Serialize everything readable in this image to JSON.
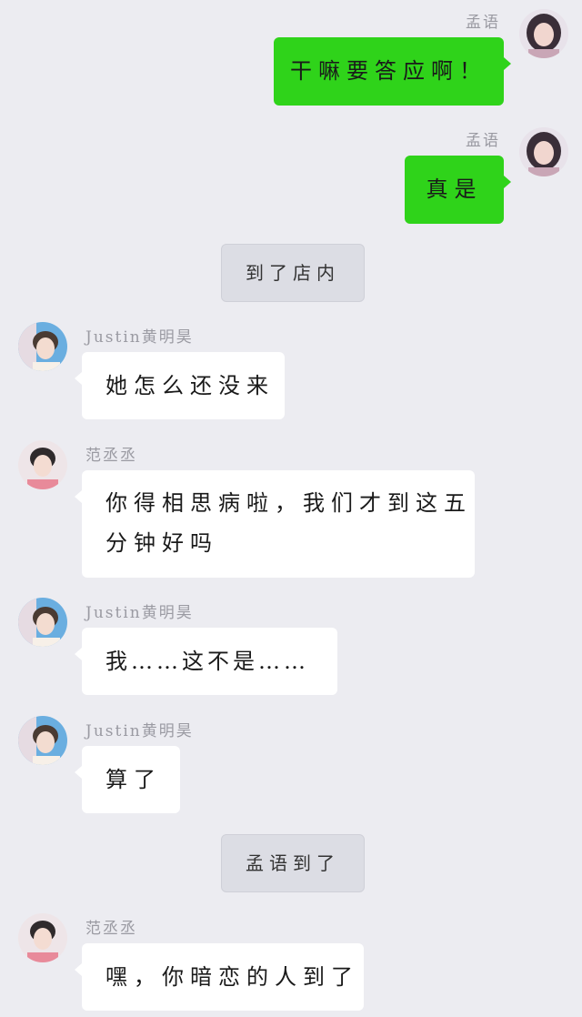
{
  "colors": {
    "background": "#ececf1",
    "bubble_self": "#2fd31a",
    "bubble_other": "#ffffff",
    "system_notice": "#dcdde4"
  },
  "messages": [
    {
      "sender": "孟语",
      "side": "right",
      "avatar": "girl-avatar",
      "text": "干嘛要答应啊！"
    },
    {
      "sender": "孟语",
      "side": "right",
      "avatar": "girl-avatar",
      "text": "真是"
    },
    {
      "type": "system",
      "text": "到了店内"
    },
    {
      "sender": "Justin黄明昊",
      "side": "left",
      "avatar": "justin-avatar",
      "text": "她怎么还没来"
    },
    {
      "sender": "范丞丞",
      "side": "left",
      "avatar": "fan-avatar",
      "line1": "你得相思病啦，我们才到这五",
      "line2": "分钟好吗"
    },
    {
      "sender": "Justin黄明昊",
      "side": "left",
      "avatar": "justin-avatar",
      "text": "我……这不是……"
    },
    {
      "sender": "Justin黄明昊",
      "side": "left",
      "avatar": "justin-avatar",
      "text": "算了"
    },
    {
      "type": "system",
      "text": "孟语到了"
    },
    {
      "sender": "范丞丞",
      "side": "left",
      "avatar": "fan-avatar",
      "text": "嘿，你暗恋的人到了"
    }
  ]
}
